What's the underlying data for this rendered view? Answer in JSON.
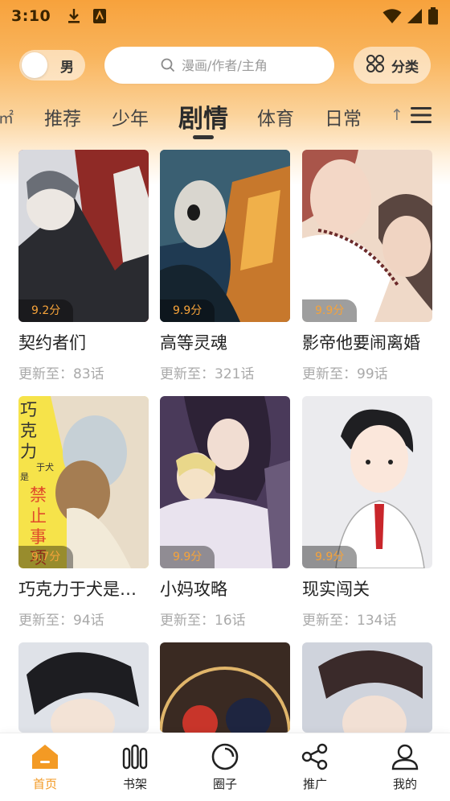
{
  "status_bar": {
    "time": "3:10"
  },
  "header": {
    "gender_toggle_label": "男",
    "search_placeholder": "漫画/作者/主角",
    "category_label": "分类"
  },
  "tabs": {
    "items": [
      {
        "label": "推荐"
      },
      {
        "label": "少年"
      },
      {
        "label": "剧情"
      },
      {
        "label": "体育"
      },
      {
        "label": "日常"
      }
    ],
    "active_index": 2
  },
  "comics": [
    {
      "title": "契约者们",
      "score": "9.2分",
      "update": "更新至：83话"
    },
    {
      "title": "高等灵魂",
      "score": "9.9分",
      "update": "更新至：321话"
    },
    {
      "title": "影帝他要闹离婚",
      "score": "9.9分",
      "update": "更新至：99话"
    },
    {
      "title": "巧克力于犬是禁止事项",
      "score": "9.7分",
      "update": "更新至：94话",
      "cover_text": [
        "巧",
        "克",
        "力",
        "于犬",
        "是",
        "禁",
        "止",
        "事",
        "项"
      ]
    },
    {
      "title": "小妈攻略",
      "score": "9.9分",
      "update": "更新至：16话"
    },
    {
      "title": "现实闯关",
      "score": "9.9分",
      "update": "更新至：134话"
    }
  ],
  "bottom_nav": {
    "items": [
      {
        "label": "首页",
        "icon": "home-icon"
      },
      {
        "label": "书架",
        "icon": "bookshelf-icon"
      },
      {
        "label": "圈子",
        "icon": "circle-icon"
      },
      {
        "label": "推广",
        "icon": "share-icon"
      },
      {
        "label": "我的",
        "icon": "profile-icon"
      }
    ],
    "active_index": 0
  },
  "colors": {
    "accent": "#f39a24",
    "score": "#f6a33a",
    "header_top": "#f7a23c"
  }
}
